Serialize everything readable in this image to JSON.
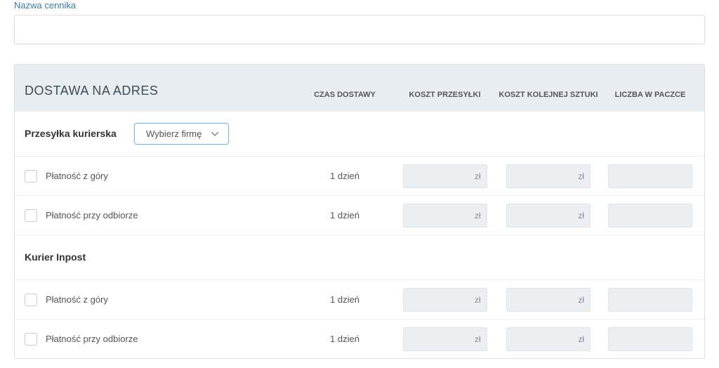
{
  "topLabel": "Nazwa cennika",
  "nameValue": "",
  "panel": {
    "title": "DOSTAWA NA ADRES",
    "columns": {
      "time": "CZAS DOSTAWY",
      "ship": "KOSZT PRZESYŁKI",
      "next": "KOSZT KOLEJNEJ SZTUKI",
      "count": "LICZBA W PACZCE"
    }
  },
  "dropdown": {
    "label": "Wybierz firmę"
  },
  "currency": "zł",
  "sections": {
    "courier": {
      "title": "Przesyłka kurierska",
      "rows": {
        "upfront": {
          "label": "Płatność z góry",
          "time": "1 dzień"
        },
        "cod": {
          "label": "Płatność przy odbiorze",
          "time": "1 dzień"
        }
      }
    },
    "inpost": {
      "title": "Kurier Inpost",
      "rows": {
        "upfront": {
          "label": "Płatność z góry",
          "time": "1 dzień"
        },
        "cod": {
          "label": "Płatność przy odbiorze",
          "time": "1 dzień"
        }
      }
    }
  }
}
